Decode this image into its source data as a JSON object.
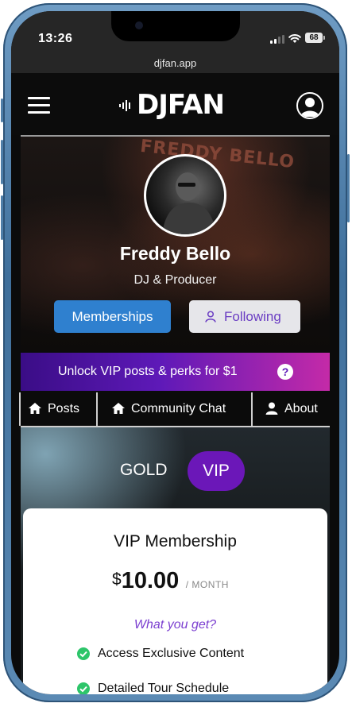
{
  "status_bar": {
    "time": "13:26",
    "battery": "68"
  },
  "browser": {
    "url": "djfan.app"
  },
  "header": {
    "logo_text": "DJFAN"
  },
  "profile": {
    "banner_text": "FREDDY BELLO",
    "name": "Freddy Bello",
    "role": "DJ & Producer",
    "memberships_button": "Memberships",
    "following_button": "Following"
  },
  "promo": {
    "text": "Unlock VIP posts & perks for $1",
    "help_icon": "?"
  },
  "tabs": [
    {
      "label": "Posts",
      "icon": "home-icon"
    },
    {
      "label": "Community Chat",
      "icon": "home-icon"
    },
    {
      "label": "About",
      "icon": "user-icon"
    }
  ],
  "tiers": {
    "gold": "GOLD",
    "vip": "VIP",
    "selected": "VIP"
  },
  "membership_card": {
    "title": "VIP Membership",
    "currency": "$",
    "amount": "10.00",
    "period": "/ MONTH",
    "what_you_get": "What you get?",
    "features": [
      "Access Exclusive Content",
      "Detailed Tour Schedule"
    ]
  },
  "colors": {
    "memberships_button": "#2f80cf",
    "vip_tier": "#6b17b8",
    "promo_gradient_start": "#3a0d86",
    "promo_gradient_end": "#c42aa8",
    "check": "#2dc56a",
    "accent_text": "#7b3fd0"
  }
}
